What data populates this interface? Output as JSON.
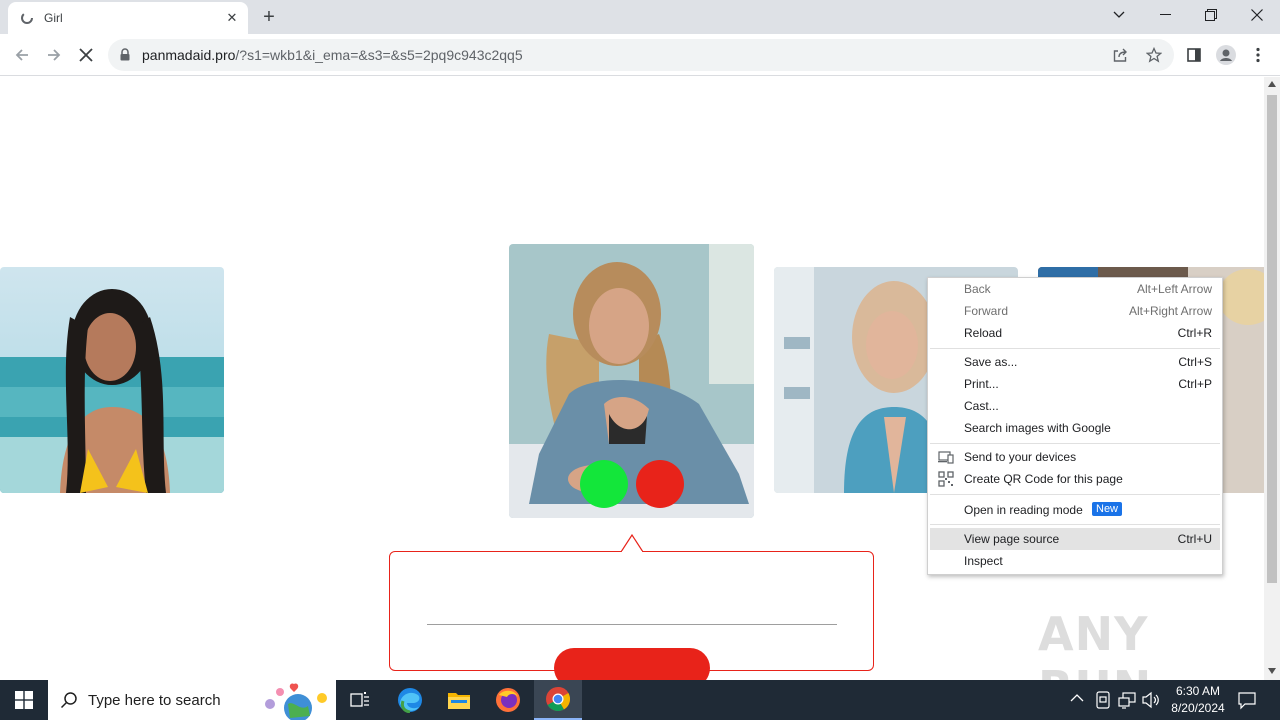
{
  "browser": {
    "tab": {
      "title": "Girl",
      "close_glyph": "✕"
    },
    "new_tab_glyph": "+",
    "url": {
      "host": "panmadaid.pro",
      "path": "/?s1=wkb1&i_ema=&s3=&s5=2pq9c943c2qq5"
    }
  },
  "context_menu": {
    "items": [
      {
        "label": "Back",
        "shortcut": "Alt+Left Arrow",
        "enabled": false
      },
      {
        "label": "Forward",
        "shortcut": "Alt+Right Arrow",
        "enabled": false
      },
      {
        "label": "Reload",
        "shortcut": "Ctrl+R",
        "enabled": true
      },
      {
        "label": "Save as...",
        "shortcut": "Ctrl+S",
        "enabled": true
      },
      {
        "label": "Print...",
        "shortcut": "Ctrl+P",
        "enabled": true
      },
      {
        "label": "Cast...",
        "shortcut": "",
        "enabled": true
      },
      {
        "label": "Search images with Google",
        "shortcut": "",
        "enabled": true
      },
      {
        "label": "Send to your devices",
        "shortcut": "",
        "icon": "devices-icon",
        "enabled": true
      },
      {
        "label": "Create QR Code for this page",
        "shortcut": "",
        "icon": "qr-code-icon",
        "enabled": true
      },
      {
        "label": "Open in reading mode",
        "shortcut": "",
        "badge": "New",
        "enabled": true
      },
      {
        "label": "View page source",
        "shortcut": "Ctrl+U",
        "enabled": true,
        "highlighted": true
      },
      {
        "label": "Inspect",
        "shortcut": "",
        "enabled": true
      }
    ]
  },
  "page": {
    "accept_color": "#13e63a",
    "reject_color": "#e8231a",
    "watermark": "ANY RUN"
  },
  "taskbar": {
    "search_placeholder": "Type here to search",
    "time": "6:30 AM",
    "date": "8/20/2024"
  }
}
